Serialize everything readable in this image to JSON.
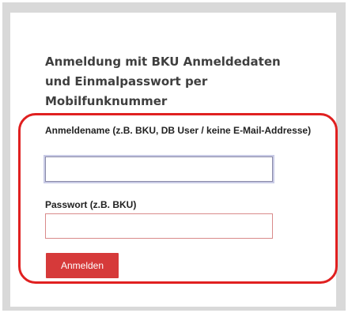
{
  "login": {
    "heading": "Anmeldung mit BKU Anmeldedaten und Einmalpasswort per Mobilfunknummer",
    "username_label": "Anmeldename (z.B. BKU, DB User / keine E-Mail-Addresse)",
    "username_value": "",
    "password_label": "Passwort (z.B. BKU)",
    "password_value": "",
    "submit_label": "Anmelden"
  },
  "colors": {
    "highlight_border": "#e02020",
    "button_background": "#d63a3a",
    "frame_background": "#d9d9d9"
  }
}
